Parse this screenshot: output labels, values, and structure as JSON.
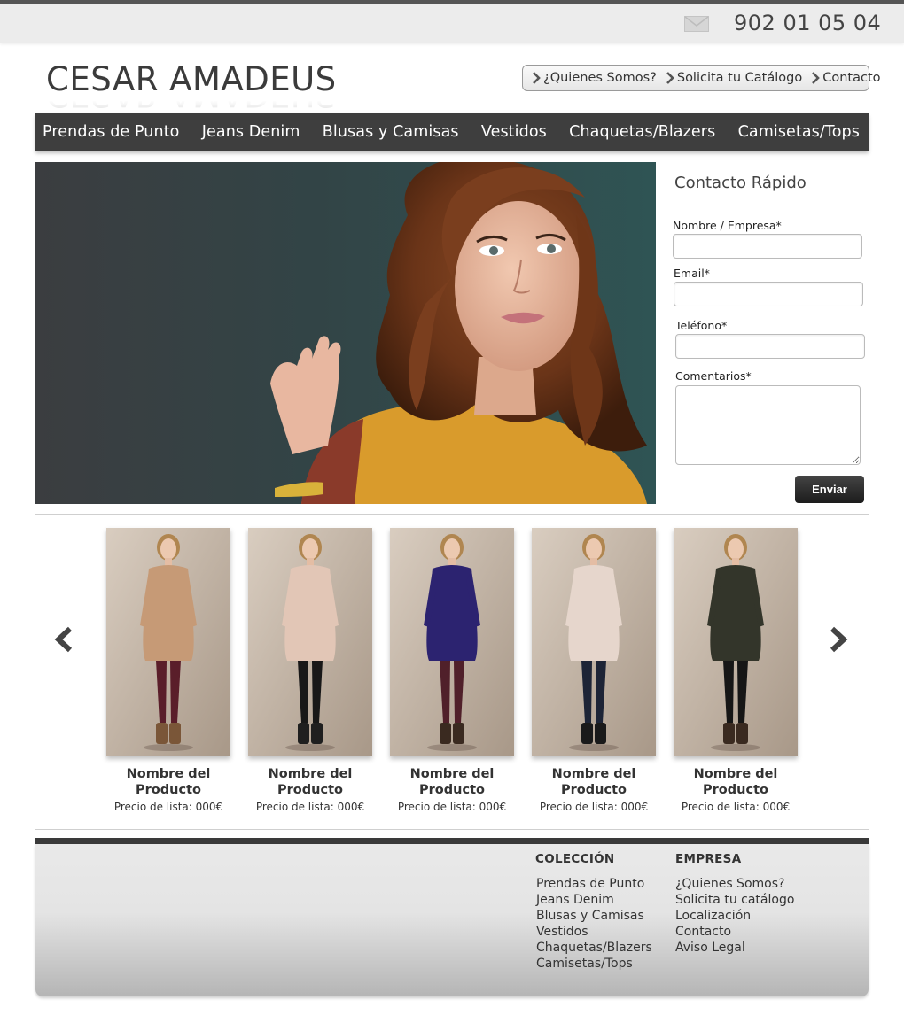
{
  "header": {
    "phone": "902 01 05 04",
    "mail_icon": "envelope-icon",
    "logo": "CESAR AMADEUS",
    "top_links": [
      "¿Quienes Somos?",
      "Solicita tu Catálogo",
      "Contacto"
    ]
  },
  "nav": {
    "items": [
      "Prendas de Punto",
      "Jeans Denim",
      "Blusas y Camisas",
      "Vestidos",
      "Chaquetas/Blazers",
      "Camisetas/Tops"
    ]
  },
  "contact_form": {
    "title": "Contacto Rápido",
    "fields": {
      "name_label": "Nombre / Empresa*",
      "email_label": "Email*",
      "phone_label": "Teléfono*",
      "comments_label": "Comentarios*"
    },
    "submit_label": "Enviar"
  },
  "carousel": {
    "prev_icon": "chevron-left-icon",
    "next_icon": "chevron-right-icon",
    "products": [
      {
        "name_line1": "Nombre del",
        "name_line2": "Producto",
        "price": "Precio de lista: 000€",
        "colors": {
          "top": "#c69a76",
          "legs": "#5a1e2a",
          "shoes": "#7a5638"
        }
      },
      {
        "name_line1": "Nombre del",
        "name_line2": "Producto",
        "price": "Precio de lista: 000€",
        "colors": {
          "top": "#e2c6b6",
          "legs": "#181818",
          "shoes": "#1f1f1f"
        }
      },
      {
        "name_line1": "Nombre del",
        "name_line2": "Producto",
        "price": "Precio de lista: 000€",
        "colors": {
          "top": "#2c2370",
          "legs": "#50202a",
          "shoes": "#3a2a20"
        }
      },
      {
        "name_line1": "Nombre del",
        "name_line2": "Producto",
        "price": "Precio de lista: 000€",
        "colors": {
          "top": "#e6d6cc",
          "legs": "#1d2436",
          "shoes": "#1a1a1a"
        }
      },
      {
        "name_line1": "Nombre del",
        "name_line2": "Producto",
        "price": "Precio de lista: 000€",
        "colors": {
          "top": "#33352a",
          "legs": "#161616",
          "shoes": "#3a2a20"
        }
      }
    ]
  },
  "footer": {
    "col1": {
      "heading": "COLECCIÓN",
      "links": [
        "Prendas de Punto",
        "Jeans Denim",
        "Blusas y Camisas",
        "Vestidos",
        "Chaquetas/Blazers",
        "Camisetas/Tops"
      ]
    },
    "col2": {
      "heading": "EMPRESA",
      "links": [
        "¿Quienes Somos?",
        "Solicita tu catálogo",
        "Localización",
        "Contacto",
        "Aviso Legal"
      ]
    }
  },
  "colors": {
    "nav_bg": "#3e3e3e",
    "button_bg": "#1c1c1c",
    "topbar_bg": "#ececec"
  }
}
